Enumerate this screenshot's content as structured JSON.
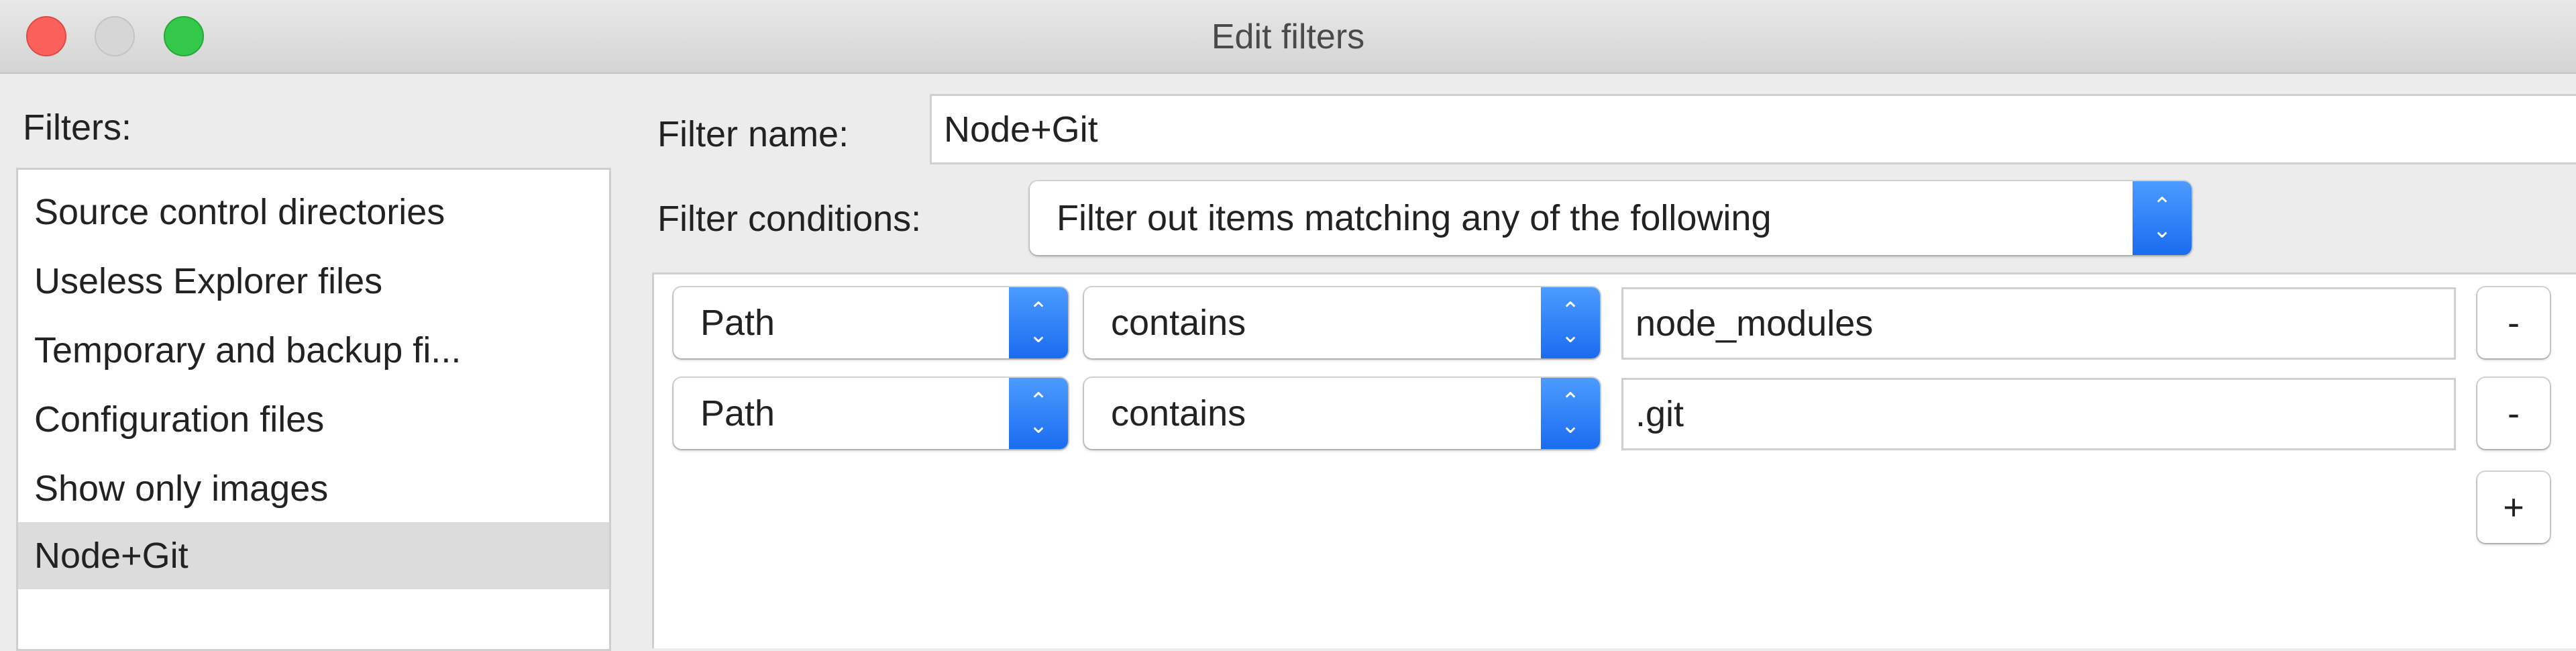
{
  "window": {
    "title": "Edit filters"
  },
  "sidebar": {
    "label": "Filters:",
    "items": [
      {
        "label": "Source control directories"
      },
      {
        "label": "Useless Explorer files"
      },
      {
        "label": "Temporary and backup fi..."
      },
      {
        "label": "Configuration files"
      },
      {
        "label": "Show only images"
      },
      {
        "label": "Node+Git",
        "selected": true
      }
    ]
  },
  "form": {
    "name_label": "Filter name:",
    "name_value": "Node+Git",
    "conditions_label": "Filter conditions:",
    "conditions_value": "Filter out items matching any of the following"
  },
  "rules": [
    {
      "field": "Path",
      "operator": "contains",
      "value": "node_modules",
      "remove_label": "-"
    },
    {
      "field": "Path",
      "operator": "contains",
      "value": ".git",
      "remove_label": "-"
    }
  ],
  "add_label": "+",
  "colors": {
    "accent": "#1a6cf0",
    "selected_row": "#dcdcdc",
    "close": "#fc605b",
    "minimize_disabled": "#d0d0d0",
    "zoom": "#34c84a"
  }
}
